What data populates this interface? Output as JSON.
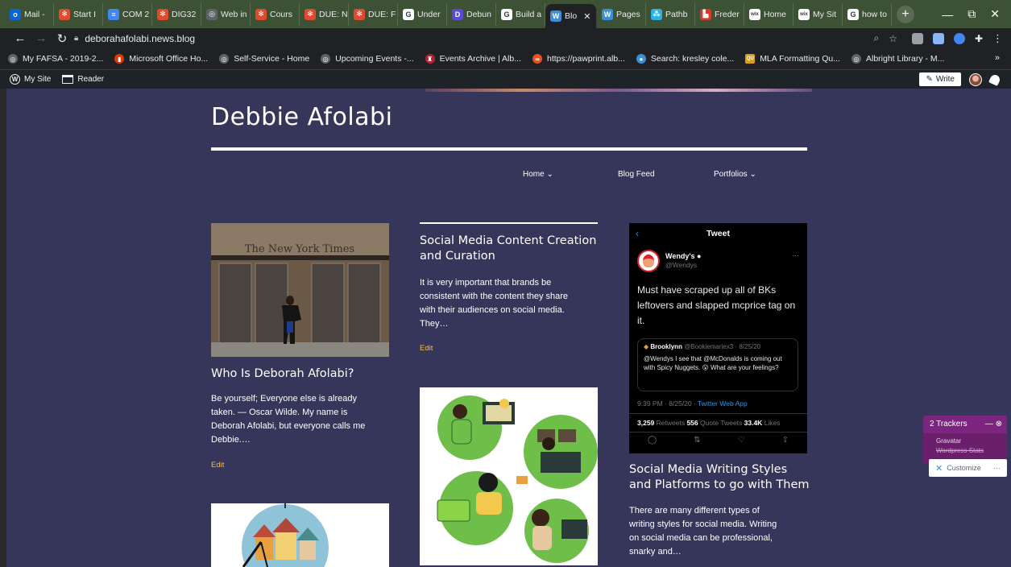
{
  "browser": {
    "tabs": [
      {
        "label": "Mail -",
        "color": "#0a64d6",
        "glyph": "o"
      },
      {
        "label": "Start I",
        "color": "#e04a2e",
        "glyph": "✻"
      },
      {
        "label": "COM 2",
        "color": "#4285f4",
        "glyph": "≡"
      },
      {
        "label": "DIG32",
        "color": "#e04a2e",
        "glyph": "✻"
      },
      {
        "label": "Web in",
        "color": "#5f6368",
        "glyph": "◎"
      },
      {
        "label": "Cours",
        "color": "#e04a2e",
        "glyph": "✻"
      },
      {
        "label": "DUE: N",
        "color": "#e04a2e",
        "glyph": "✻"
      },
      {
        "label": "DUE: F",
        "color": "#e04a2e",
        "glyph": "✻"
      },
      {
        "label": "Under",
        "color": "#ffffff",
        "glyph": "G"
      },
      {
        "label": "Debun",
        "color": "#5b4ad6",
        "glyph": "D"
      },
      {
        "label": "Build a",
        "color": "#ffffff",
        "glyph": "G"
      },
      {
        "label": "Blo",
        "color": "#3a8fd6",
        "glyph": "W",
        "active": true
      },
      {
        "label": "Pages",
        "color": "#3a8fd6",
        "glyph": "W"
      },
      {
        "label": "Pathb",
        "color": "#2bb0e8",
        "glyph": "⁂"
      },
      {
        "label": "Freder",
        "color": "#d63a2a",
        "glyph": "▙"
      },
      {
        "label": "Home",
        "color": "#ffffff",
        "glyph": "wix"
      },
      {
        "label": "My Sit",
        "color": "#ffffff",
        "glyph": "wix"
      },
      {
        "label": "how to",
        "color": "#ffffff",
        "glyph": "G"
      }
    ],
    "url": "deborahafolabi.news.blog",
    "bookmarks": [
      {
        "label": "My FAFSA - 2019-2...",
        "color": "#5f6368",
        "glyph": "◎"
      },
      {
        "label": "Microsoft Office Ho...",
        "color": "#d83b01",
        "glyph": "▮"
      },
      {
        "label": "Self-Service - Home",
        "color": "#5f6368",
        "glyph": "◎"
      },
      {
        "label": "Upcoming Events -...",
        "color": "#5f6368",
        "glyph": "◎"
      },
      {
        "label": "Events Archive | Alb...",
        "color": "#b22234",
        "glyph": "♜"
      },
      {
        "label": "https://pawprint.alb...",
        "color": "#e8501e",
        "glyph": "∞"
      },
      {
        "label": "Search: kresley cole...",
        "color": "#3a8fd6",
        "glyph": "●"
      },
      {
        "label": "MLA Formatting Qu...",
        "color": "#d4a017",
        "glyph": "QU"
      },
      {
        "label": "Albright Library - M...",
        "color": "#5f6368",
        "glyph": "◎"
      }
    ],
    "bookmarks_more": "»"
  },
  "wpbar": {
    "my_site": "My Site",
    "reader": "Reader",
    "write": "Write"
  },
  "site": {
    "title": "Debbie Afolabi",
    "menu": [
      {
        "label": "Home ⌄"
      },
      {
        "label": "Blog Feed"
      },
      {
        "label": "Portfolios ⌄"
      }
    ]
  },
  "posts": [
    {
      "title": "Who Is Deborah Afolabi?",
      "excerpt_lines": [
        "Be yourself; Everyone else is already",
        "taken. — Oscar Wilde. My name is",
        "Deborah Afolabi, but everyone calls me",
        "Debbie.…"
      ],
      "edit": "Edit"
    },
    {
      "title_lines": [
        "Social Media Content Creation",
        "and Curation"
      ],
      "excerpt_lines": [
        "It is very important that brands be",
        "consistent with the content they share",
        "with their audiences on social media.",
        "They…"
      ],
      "edit": "Edit"
    },
    {
      "title_lines": [
        "Social Media Writing Styles",
        "and Platforms to go with Them"
      ],
      "excerpt_lines": [
        "There are many different types of",
        "writing styles for social media. Writing",
        "on social media can be professional,",
        "snarky and…"
      ]
    }
  ],
  "tweet": {
    "header": "Tweet",
    "name": "Wendy's",
    "handle": "@Wendys",
    "text": "Must have scraped up all of BKs leftovers and slapped mcprice tag on it.",
    "quote_name": "Brooklynn",
    "quote_handle": "@Bookiemariex3 · 8/25/20",
    "quote_text": "@Wendys I see that @McDonalds is coming out with Spicy Nuggets. 😮 What are your feelings?",
    "meta_time": "9:39 PM · 8/25/20 · ",
    "meta_app": "Twitter Web App",
    "retweets": "3,259",
    "retweets_label": " Retweets ",
    "quotes": "556",
    "quotes_label": " Quote Tweets ",
    "likes": "33.4K",
    "likes_label": " Likes"
  },
  "trackers": {
    "title": "2 Trackers",
    "items": [
      "Gravatar",
      "Wordpress Stats"
    ],
    "customize": "Customize"
  }
}
